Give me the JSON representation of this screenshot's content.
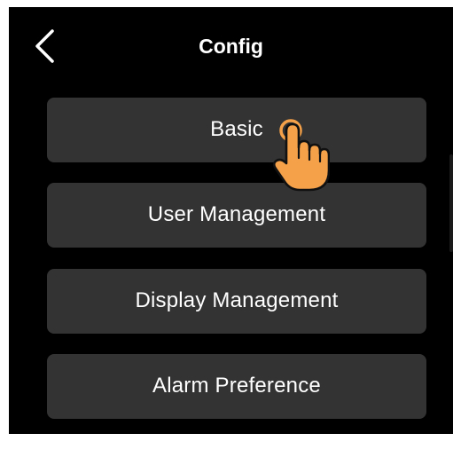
{
  "header": {
    "title": "Config",
    "back_icon": "chevron-left-icon"
  },
  "menu": {
    "items": [
      {
        "label": "Basic"
      },
      {
        "label": "User Management"
      },
      {
        "label": "Display Management"
      },
      {
        "label": "Alarm Preference"
      }
    ]
  },
  "overlay": {
    "pointer_icon": "tap-hand-icon",
    "pointer_target": "Basic"
  },
  "colors": {
    "screen_background": "#000000",
    "button_background": "#333333",
    "text": "#ffffff",
    "hand_fill": "#f5a14a",
    "hand_outline": "#111111"
  }
}
